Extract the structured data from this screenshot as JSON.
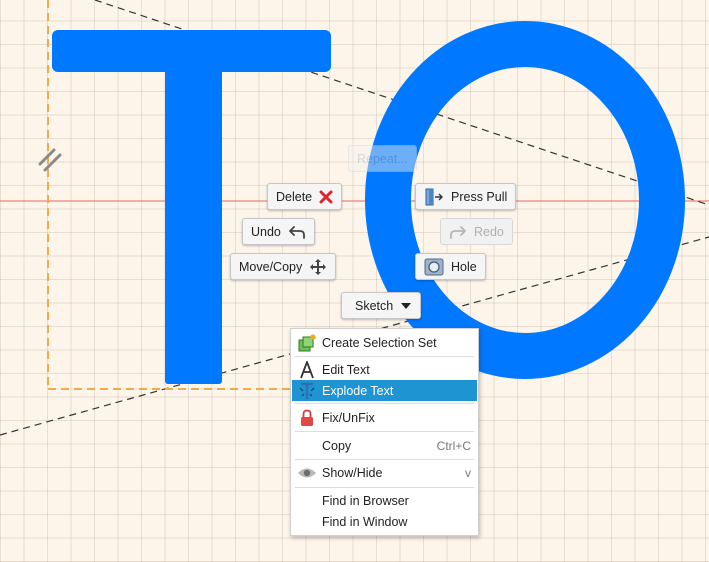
{
  "canvas_text": {
    "letter_1": "T",
    "letter_2": "O",
    "text_color": "#0078ff"
  },
  "marking_menu": {
    "repeat": "Repeat...",
    "delete": "Delete",
    "press_pull": "Press Pull",
    "undo": "Undo",
    "redo": "Redo",
    "move_copy": "Move/Copy",
    "hole": "Hole",
    "sketch": "Sketch"
  },
  "context_menu": {
    "items": [
      {
        "label": "Create Selection Set",
        "icon": "selection-set-icon",
        "shortcut": ""
      },
      {
        "label": "Edit Text",
        "icon": "text-a-icon",
        "shortcut": ""
      },
      {
        "label": "Explode Text",
        "icon": "explode-text-icon",
        "shortcut": "",
        "selected": true
      },
      {
        "label": "Fix/UnFix",
        "icon": "lock-icon",
        "shortcut": ""
      },
      {
        "label": "Copy",
        "icon": "",
        "shortcut": "Ctrl+C"
      },
      {
        "label": "Show/Hide",
        "icon": "eye-icon",
        "shortcut": "v"
      },
      {
        "label": "Find in Browser",
        "icon": "",
        "shortcut": ""
      },
      {
        "label": "Find in Window",
        "icon": "",
        "shortcut": ""
      }
    ]
  },
  "colors": {
    "accent": "#1e94d2",
    "delete_red": "#e0232b",
    "canvas_bg": "#fdf5ea",
    "sketch_orange": "#f5a94e"
  }
}
